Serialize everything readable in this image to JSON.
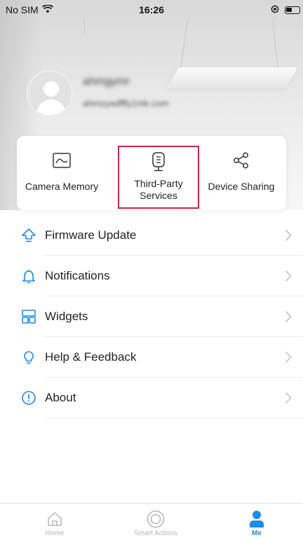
{
  "status_bar": {
    "carrier": "No SIM",
    "time": "16:26"
  },
  "profile": {
    "name": "ahmgymr",
    "email": "ahmzyadfffy1mk.com"
  },
  "features": [
    {
      "label": "Camera Memory",
      "icon": "camera-memory-icon"
    },
    {
      "label": "Third-Party Services",
      "icon": "third-party-services-icon"
    },
    {
      "label": "Device Sharing",
      "icon": "share-icon"
    }
  ],
  "menu": [
    {
      "label": "Firmware Update",
      "icon": "firmware-update-icon"
    },
    {
      "label": "Notifications",
      "icon": "bell-icon"
    },
    {
      "label": "Widgets",
      "icon": "widgets-icon"
    },
    {
      "label": "Help & Feedback",
      "icon": "lightbulb-icon"
    },
    {
      "label": "About",
      "icon": "info-icon"
    }
  ],
  "tabs": [
    {
      "label": "Home",
      "icon": "home-icon",
      "active": false
    },
    {
      "label": "Smart Actions",
      "icon": "smart-actions-icon",
      "active": false
    },
    {
      "label": "Me",
      "icon": "person-icon",
      "active": true
    }
  ],
  "colors": {
    "accent": "#1d8be8",
    "highlight_border": "#c8283c",
    "text": "#222222",
    "muted": "#b5b5b5"
  }
}
